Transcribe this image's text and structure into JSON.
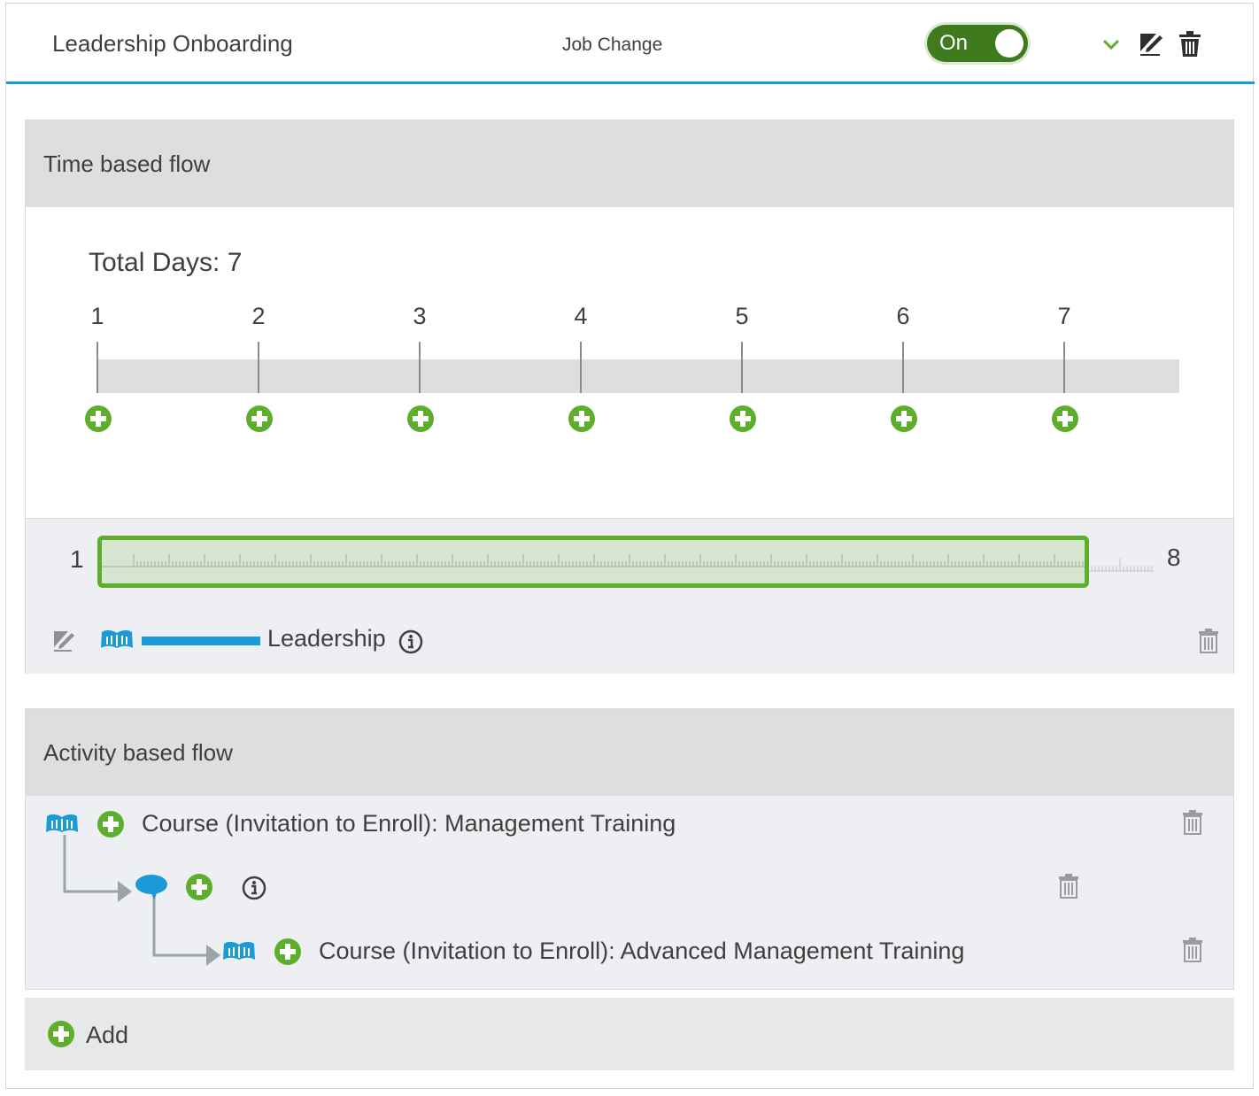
{
  "header": {
    "title": "Leadership Onboarding",
    "trigger_type": "Job Change",
    "toggle_label": "On",
    "toggle_state": "on"
  },
  "time_flow": {
    "title": "Time based flow",
    "total_days_label": "Total Days: 7",
    "days": [
      "1",
      "2",
      "3",
      "4",
      "5",
      "6",
      "7"
    ],
    "range": {
      "start": "1",
      "end": "8"
    },
    "segment": {
      "label": "Leadership",
      "icon": "book-icon",
      "color": "#1a9ad6"
    }
  },
  "activity_flow": {
    "title": "Activity based flow",
    "items": [
      {
        "icon": "book-icon",
        "label": "Course (Invitation to Enroll): Management Training"
      },
      {
        "icon": "chat-bubble-icon",
        "label": ""
      },
      {
        "icon": "book-icon",
        "label": "Course (Invitation to Enroll): Advanced Management Training"
      }
    ]
  },
  "add": {
    "label": "Add"
  },
  "colors": {
    "accent_blue": "#1a9ad6",
    "add_green": "#5cae2c",
    "toggle_green": "#3f7a1f",
    "panel_gray": "#dddee0"
  }
}
